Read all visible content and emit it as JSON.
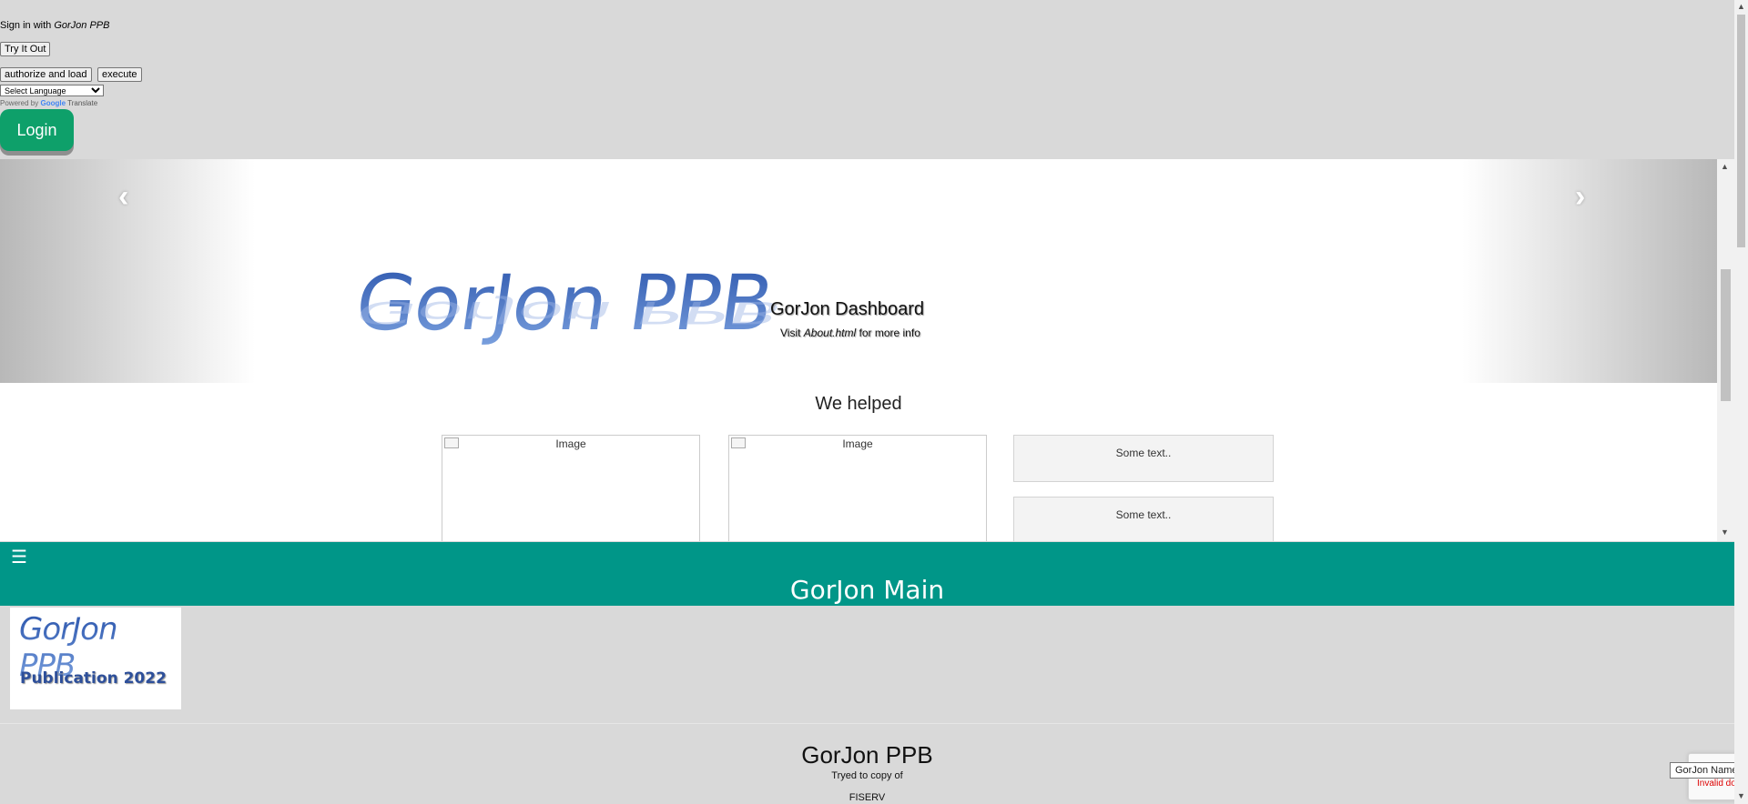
{
  "signin": {
    "prefix": "Sign in with ",
    "brand": "GorJon PPB"
  },
  "buttons": {
    "try": "Try It Out",
    "authorize": "authorize and load",
    "execute": "execute",
    "login": "Login"
  },
  "language": {
    "selected": "Select Language",
    "powered_by": "Powered by",
    "google": "Google",
    "translate": "Translate"
  },
  "carousel": {
    "logo_text": "GorJon PPB",
    "title": "GorJon Dashboard",
    "sub_prefix": "Visit ",
    "sub_link": "About.html",
    "sub_suffix": " for more info",
    "prev": "‹",
    "next": "›"
  },
  "helped": {
    "heading": "We helped",
    "images": [
      "Image",
      "Image"
    ],
    "texts": [
      "Some text..",
      "Some text.."
    ]
  },
  "topbar": {
    "menu": "☰",
    "title": "GorJon Main"
  },
  "publication": {
    "line1": "GorJon PPB",
    "line2": "Publication 2022"
  },
  "footer": {
    "title": "GorJon PPB",
    "line1": "Tryed to copy of",
    "line2": "FISERV"
  },
  "tooltip": {
    "text": "GorJon Name",
    "invalid": "Invalid do"
  },
  "scroll": {
    "up": "▲",
    "down": "▼"
  }
}
